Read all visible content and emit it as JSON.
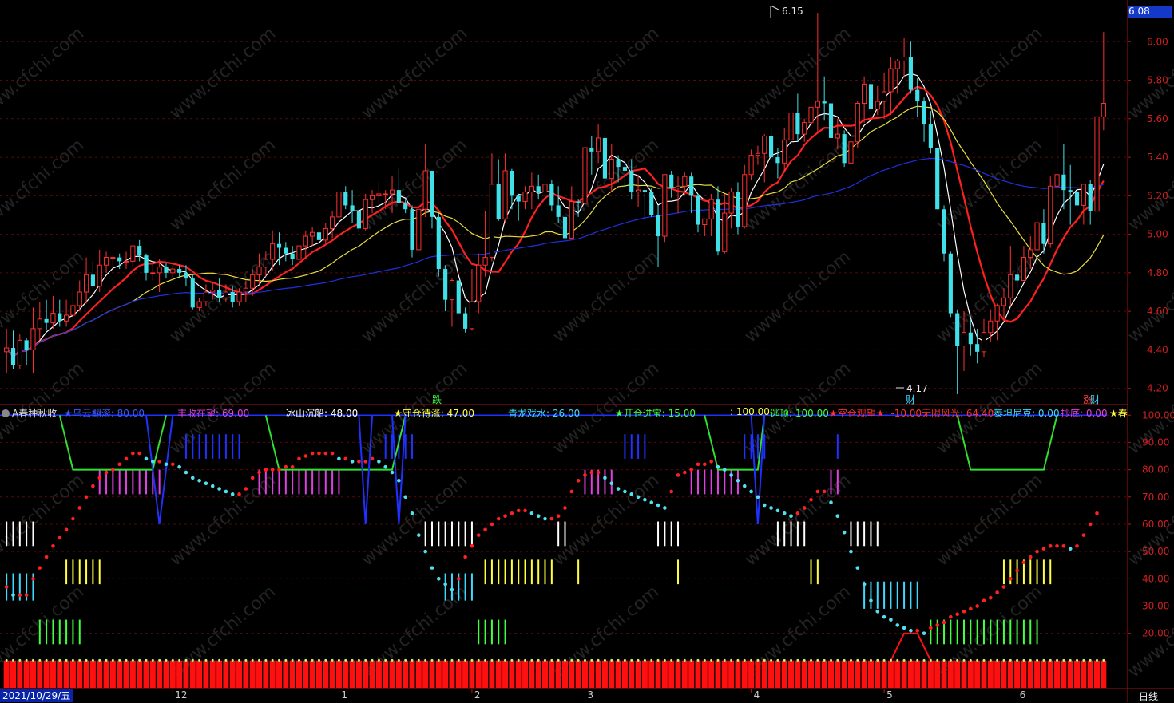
{
  "header": {
    "indicator_title": "A春种秋收",
    "current_price": "6.08"
  },
  "indicator_labels": [
    {
      "text": "★乌云翻滚: 80.00",
      "color": "#3a5cff"
    },
    {
      "text": "丰收在望: 69.00",
      "color": "#e040e0"
    },
    {
      "text": "冰山沉船: 48.00",
      "color": "#ffffff"
    },
    {
      "text": "★守仓待涨: 47.00",
      "color": "#ffff40"
    },
    {
      "text": "青龙戏水: 26.00",
      "color": "#40d8ff"
    },
    {
      "text": "★开仓进宝: 15.00",
      "color": "#40ff40"
    },
    {
      "text": ": 100.00",
      "color": "#ffff40"
    },
    {
      "text": "逃顶: 100.00",
      "color": "#40ff40"
    },
    {
      "text": "★空仓观望★: -10.00",
      "color": "#ff3030"
    },
    {
      "text": "无限风光: 64.40",
      "color": "#ff3030"
    },
    {
      "text": "泰坦尼克: 0.00",
      "color": "#40d8ff"
    },
    {
      "text": "抄底: 0.00",
      "color": "#e040e0"
    },
    {
      "text": "★春",
      "color": "#ffff40"
    }
  ],
  "markers": [
    {
      "text": "跌",
      "color": "#40ff40"
    },
    {
      "text": "财",
      "color": "#40d8ff"
    },
    {
      "text": "涨",
      "color": "#ff4040"
    },
    {
      "text": "财",
      "color": "#40d8ff"
    }
  ],
  "extremes": {
    "high": "6.15",
    "low": "4.17"
  },
  "footer": {
    "date": "2021/10/29/五",
    "period": "日线",
    "month_ticks": [
      "12",
      "1",
      "2",
      "3",
      "4",
      "5",
      "6"
    ]
  },
  "chart_data": [
    {
      "type": "candlestick",
      "y_ticks": [
        "6.00",
        "5.80",
        "5.60",
        "5.40",
        "5.20",
        "5.00",
        "4.80",
        "4.60",
        "4.40",
        "4.20"
      ],
      "ylim": [
        4.12,
        6.2
      ],
      "up_color": "#ff3030",
      "down_color": "#40e0e8",
      "ma_colors": [
        "#ffffff",
        "#ff2020",
        "#e8e040",
        "#2030e0"
      ],
      "ohlc": [
        [
          4.39,
          4.51,
          4.28,
          4.41
        ],
        [
          4.41,
          4.5,
          4.3,
          4.32
        ],
        [
          4.32,
          4.48,
          4.3,
          4.45
        ],
        [
          4.45,
          4.46,
          4.32,
          4.4
        ],
        [
          4.4,
          4.62,
          4.28,
          4.51
        ],
        [
          4.51,
          4.65,
          4.45,
          4.56
        ],
        [
          4.56,
          4.66,
          4.5,
          4.54
        ],
        [
          4.54,
          4.68,
          4.51,
          4.59
        ],
        [
          4.59,
          4.66,
          4.52,
          4.55
        ],
        [
          4.55,
          4.66,
          4.52,
          4.58
        ],
        [
          4.58,
          4.71,
          4.53,
          4.63
        ],
        [
          4.63,
          4.76,
          4.6,
          4.7
        ],
        [
          4.7,
          4.88,
          4.64,
          4.79
        ],
        [
          4.79,
          4.86,
          4.72,
          4.73
        ],
        [
          4.73,
          4.92,
          4.7,
          4.84
        ],
        [
          4.84,
          4.91,
          4.8,
          4.88
        ],
        [
          4.88,
          4.89,
          4.81,
          4.88
        ],
        [
          4.88,
          4.9,
          4.82,
          4.86
        ],
        [
          4.86,
          4.91,
          4.82,
          4.86
        ],
        [
          4.86,
          4.94,
          4.83,
          4.94
        ],
        [
          4.94,
          4.97,
          4.86,
          4.89
        ],
        [
          4.89,
          4.9,
          4.76,
          4.8
        ],
        [
          4.8,
          4.86,
          4.76,
          4.8
        ],
        [
          4.8,
          4.87,
          4.7,
          4.83
        ],
        [
          4.83,
          4.85,
          4.77,
          4.8
        ],
        [
          4.8,
          4.84,
          4.76,
          4.82
        ],
        [
          4.82,
          4.84,
          4.77,
          4.8
        ],
        [
          4.8,
          4.84,
          4.73,
          4.77
        ],
        [
          4.77,
          4.79,
          4.61,
          4.62
        ],
        [
          4.62,
          4.67,
          4.6,
          4.65
        ],
        [
          4.65,
          4.74,
          4.63,
          4.7
        ],
        [
          4.7,
          4.75,
          4.66,
          4.71
        ],
        [
          4.71,
          4.77,
          4.65,
          4.67
        ],
        [
          4.67,
          4.74,
          4.65,
          4.7
        ],
        [
          4.7,
          4.73,
          4.62,
          4.65
        ],
        [
          4.65,
          4.72,
          4.63,
          4.7
        ],
        [
          4.7,
          4.76,
          4.65,
          4.72
        ],
        [
          4.72,
          4.82,
          4.68,
          4.79
        ],
        [
          4.79,
          4.9,
          4.74,
          4.83
        ],
        [
          4.83,
          4.91,
          4.78,
          4.87
        ],
        [
          4.87,
          5.02,
          4.81,
          4.95
        ],
        [
          4.95,
          5.01,
          4.84,
          4.93
        ],
        [
          4.93,
          4.96,
          4.86,
          4.9
        ],
        [
          4.9,
          4.94,
          4.84,
          4.87
        ],
        [
          4.87,
          4.96,
          4.82,
          4.94
        ],
        [
          4.94,
          5.02,
          4.88,
          4.99
        ],
        [
          4.99,
          5.04,
          4.94,
          5.01
        ],
        [
          5.01,
          5.04,
          4.94,
          4.97
        ],
        [
          4.97,
          5.06,
          4.95,
          5.03
        ],
        [
          5.03,
          5.12,
          4.98,
          5.09
        ],
        [
          5.09,
          5.22,
          5.04,
          5.22
        ],
        [
          5.22,
          5.25,
          5.13,
          5.15
        ],
        [
          5.15,
          5.23,
          5.06,
          5.12
        ],
        [
          5.12,
          5.14,
          5.01,
          5.03
        ],
        [
          5.03,
          5.21,
          5.02,
          5.18
        ],
        [
          5.18,
          5.23,
          5.11,
          5.2
        ],
        [
          5.2,
          5.27,
          5.16,
          5.21
        ],
        [
          5.21,
          5.23,
          5.13,
          5.21
        ],
        [
          5.21,
          5.3,
          5.11,
          5.23
        ],
        [
          5.23,
          5.34,
          5.17,
          5.16
        ],
        [
          5.16,
          5.18,
          5.11,
          5.13
        ],
        [
          5.13,
          5.15,
          4.88,
          4.92
        ],
        [
          4.92,
          5.13,
          4.92,
          5.13
        ],
        [
          5.13,
          5.47,
          5.09,
          5.33
        ],
        [
          5.33,
          5.33,
          5.03,
          5.09
        ],
        [
          5.09,
          5.11,
          4.78,
          4.82
        ],
        [
          4.82,
          4.84,
          4.6,
          4.66
        ],
        [
          4.66,
          4.77,
          4.52,
          4.76
        ],
        [
          4.76,
          4.76,
          4.59,
          4.59
        ],
        [
          4.59,
          4.62,
          4.49,
          4.51
        ],
        [
          4.51,
          4.82,
          4.5,
          4.65
        ],
        [
          4.65,
          4.9,
          4.59,
          4.84
        ],
        [
          4.84,
          5.12,
          4.78,
          4.88
        ],
        [
          4.88,
          5.42,
          4.86,
          5.26
        ],
        [
          5.26,
          5.39,
          5.07,
          5.08
        ],
        [
          5.08,
          5.42,
          5.06,
          5.33
        ],
        [
          5.33,
          5.34,
          5.13,
          5.2
        ],
        [
          5.2,
          5.21,
          5.07,
          5.17
        ],
        [
          5.17,
          5.25,
          5.13,
          5.22
        ],
        [
          5.22,
          5.32,
          5.13,
          5.25
        ],
        [
          5.25,
          5.31,
          5.18,
          5.22
        ],
        [
          5.22,
          5.29,
          5.1,
          5.26
        ],
        [
          5.26,
          5.28,
          5.12,
          5.15
        ],
        [
          5.15,
          5.25,
          5.06,
          5.09
        ],
        [
          5.09,
          5.16,
          4.92,
          4.98
        ],
        [
          4.98,
          5.25,
          4.98,
          5.17
        ],
        [
          5.17,
          5.18,
          5.09,
          5.16
        ],
        [
          5.16,
          5.44,
          5.06,
          5.45
        ],
        [
          5.45,
          5.51,
          5.31,
          5.43
        ],
        [
          5.43,
          5.57,
          5.37,
          5.5
        ],
        [
          5.5,
          5.52,
          5.28,
          5.29
        ],
        [
          5.29,
          5.47,
          5.22,
          5.39
        ],
        [
          5.39,
          5.41,
          5.27,
          5.35
        ],
        [
          5.35,
          5.39,
          5.24,
          5.33
        ],
        [
          5.33,
          5.39,
          5.18,
          5.22
        ],
        [
          5.22,
          5.31,
          5.14,
          5.23
        ],
        [
          5.23,
          5.24,
          5.08,
          5.22
        ],
        [
          5.22,
          5.24,
          5.09,
          5.1
        ],
        [
          5.1,
          5.15,
          4.83,
          4.99
        ],
        [
          4.99,
          5.31,
          4.96,
          5.31
        ],
        [
          5.31,
          5.33,
          5.19,
          5.24
        ],
        [
          5.24,
          5.3,
          5.11,
          5.25
        ],
        [
          5.25,
          5.32,
          5.2,
          5.3
        ],
        [
          5.3,
          5.32,
          5.11,
          5.2
        ],
        [
          5.2,
          5.21,
          5.01,
          5.05
        ],
        [
          5.05,
          5.08,
          4.99,
          5.08
        ],
        [
          5.08,
          5.21,
          4.99,
          5.18
        ],
        [
          5.18,
          5.25,
          4.89,
          4.91
        ],
        [
          4.91,
          5.21,
          4.9,
          5.11
        ],
        [
          5.11,
          5.24,
          5.03,
          5.22
        ],
        [
          5.22,
          5.27,
          5.0,
          5.04
        ],
        [
          5.04,
          5.36,
          5.03,
          5.31
        ],
        [
          5.31,
          5.44,
          5.28,
          5.41
        ],
        [
          5.41,
          5.46,
          5.36,
          5.42
        ],
        [
          5.42,
          5.52,
          5.27,
          5.51
        ],
        [
          5.51,
          5.55,
          5.39,
          5.4
        ],
        [
          5.4,
          5.45,
          5.29,
          5.37
        ],
        [
          5.37,
          5.55,
          5.32,
          5.49
        ],
        [
          5.49,
          5.67,
          5.48,
          5.63
        ],
        [
          5.63,
          5.73,
          5.48,
          5.52
        ],
        [
          5.52,
          5.6,
          5.48,
          5.58
        ],
        [
          5.58,
          5.75,
          5.49,
          5.66
        ],
        [
          5.66,
          6.15,
          5.53,
          5.69
        ],
        [
          5.69,
          5.82,
          5.59,
          5.68
        ],
        [
          5.68,
          5.75,
          5.48,
          5.5
        ],
        [
          5.5,
          5.6,
          5.44,
          5.52
        ],
        [
          5.52,
          5.54,
          5.35,
          5.37
        ],
        [
          5.37,
          5.53,
          5.33,
          5.48
        ],
        [
          5.48,
          5.69,
          5.45,
          5.68
        ],
        [
          5.68,
          5.82,
          5.58,
          5.78
        ],
        [
          5.78,
          5.84,
          5.64,
          5.65
        ],
        [
          5.65,
          5.77,
          5.62,
          5.69
        ],
        [
          5.69,
          5.84,
          5.6,
          5.74
        ],
        [
          5.74,
          5.92,
          5.62,
          5.86
        ],
        [
          5.86,
          5.91,
          5.73,
          5.9
        ],
        [
          5.9,
          6.02,
          5.82,
          5.92
        ],
        [
          5.92,
          6.0,
          5.73,
          5.75
        ],
        [
          5.75,
          5.81,
          5.61,
          5.69
        ],
        [
          5.69,
          5.71,
          5.48,
          5.57
        ],
        [
          5.57,
          5.64,
          5.42,
          5.45
        ],
        [
          5.45,
          5.45,
          5.13,
          5.13
        ],
        [
          5.13,
          5.15,
          4.86,
          4.9
        ],
        [
          4.9,
          4.91,
          4.57,
          4.59
        ],
        [
          4.59,
          4.61,
          4.17,
          4.42
        ],
        [
          4.42,
          4.6,
          4.29,
          4.49
        ],
        [
          4.49,
          4.56,
          4.37,
          4.43
        ],
        [
          4.43,
          4.51,
          4.33,
          4.39
        ],
        [
          4.39,
          4.56,
          4.36,
          4.49
        ],
        [
          4.49,
          4.61,
          4.44,
          4.55
        ],
        [
          4.55,
          4.64,
          4.45,
          4.63
        ],
        [
          4.63,
          4.72,
          4.55,
          4.67
        ],
        [
          4.67,
          4.94,
          4.63,
          4.79
        ],
        [
          4.79,
          4.85,
          4.72,
          4.76
        ],
        [
          4.76,
          4.94,
          4.76,
          4.88
        ],
        [
          4.88,
          4.99,
          4.82,
          4.92
        ],
        [
          4.92,
          5.11,
          4.86,
          5.06
        ],
        [
          5.06,
          5.13,
          4.9,
          4.95
        ],
        [
          4.95,
          5.3,
          4.93,
          5.25
        ],
        [
          5.25,
          5.58,
          5.19,
          5.31
        ],
        [
          5.31,
          5.47,
          5.13,
          5.23
        ],
        [
          5.23,
          5.36,
          5.05,
          5.22
        ],
        [
          5.22,
          5.26,
          5.11,
          5.15
        ],
        [
          5.15,
          5.26,
          5.05,
          5.26
        ],
        [
          5.26,
          5.28,
          5.05,
          5.12
        ],
        [
          5.12,
          5.67,
          5.05,
          5.61
        ],
        [
          5.61,
          6.05,
          5.54,
          5.68
        ]
      ]
    },
    {
      "type": "indicator",
      "y_ticks": [
        "100.00",
        "90.00",
        "80.00",
        "70.00",
        "60.00",
        "50.00",
        "40.00",
        "30.00",
        "20.00"
      ],
      "ylim": [
        0,
        103
      ],
      "dots": [
        37,
        34,
        34,
        34,
        40,
        44,
        48,
        52,
        55,
        58,
        62,
        66,
        70,
        74,
        77,
        79,
        80,
        82,
        84,
        86,
        86,
        84,
        83,
        83,
        82,
        82,
        81,
        79,
        77,
        76,
        75,
        74,
        73,
        72,
        71,
        71,
        73,
        77,
        79,
        80,
        80,
        80,
        81,
        81,
        84,
        85,
        86,
        86,
        86,
        86,
        84,
        84,
        83,
        83,
        83,
        84,
        83,
        81,
        79,
        76,
        70,
        64,
        56,
        50,
        44,
        40,
        38,
        36,
        40,
        48,
        52,
        56,
        58,
        60,
        62,
        63,
        64,
        65,
        65,
        64,
        63,
        62,
        62,
        63,
        66,
        72,
        76,
        78,
        79,
        79,
        77,
        75,
        73,
        72,
        71,
        70,
        69,
        68,
        67,
        66,
        72,
        78,
        79,
        80,
        82,
        82,
        83,
        81,
        80,
        78,
        76,
        74,
        72,
        70,
        67,
        66,
        65,
        64,
        63,
        64,
        66,
        69,
        72,
        72,
        68,
        63,
        57,
        50,
        44,
        38,
        32,
        28,
        26,
        25,
        23,
        22,
        21,
        21,
        20,
        22,
        23,
        24,
        26,
        27,
        28,
        29,
        30,
        32,
        33,
        35,
        37,
        40,
        43,
        46,
        48,
        50,
        51,
        52,
        52,
        52,
        51,
        52,
        56,
        60,
        64
      ],
      "bottom_bars": {
        "value": 10,
        "color": "#ff1010"
      }
    }
  ]
}
